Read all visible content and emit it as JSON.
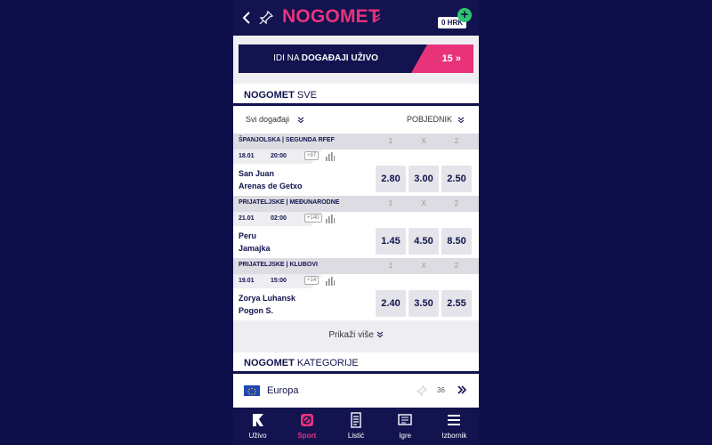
{
  "header": {
    "title": "NOGOMET",
    "wallet": "0 HRK",
    "wallet_plus": "+"
  },
  "live_banner": {
    "prefix": "IDI NA ",
    "bold": "DOGAĐAJI UŽIVO",
    "count": "15"
  },
  "section_all": {
    "bold": "NOGOMET",
    "rest": " SVE"
  },
  "filter": {
    "left": "Svi događaji",
    "right": "POBJEDNIK"
  },
  "odds_columns": [
    "1",
    "X",
    "2"
  ],
  "matches": [
    {
      "league": "ŠPANJOLSKA | SEGUNDA RFEF",
      "date": "18.01",
      "time": "20:00",
      "more": "+87",
      "team1": "San Juan",
      "team2": "Arenas de Getxo",
      "odds": [
        "2.80",
        "3.00",
        "2.50"
      ]
    },
    {
      "league": "PRIJATELJSKE | MEĐUNARODNE",
      "date": "21.01",
      "time": "02:00",
      "more": "+140",
      "team1": "Peru",
      "team2": "Jamajka",
      "odds": [
        "1.45",
        "4.50",
        "8.50"
      ]
    },
    {
      "league": "PRIJATELJSKE | KLUBOVI",
      "date": "19.01",
      "time": "15:00",
      "more": "+14",
      "team1": "Zorya Luhansk",
      "team2": "Pogon S.",
      "odds": [
        "2.40",
        "3.50",
        "2.55"
      ]
    }
  ],
  "show_more": "Prikaži više",
  "section_categories": {
    "bold": "NOGOMET",
    "rest": " KATEGORIJE"
  },
  "category": {
    "label": "Europa",
    "count": "36"
  },
  "bottom_nav": [
    {
      "label": "Uživo",
      "icon": "live-icon"
    },
    {
      "label": "Sport",
      "icon": "sport-icon"
    },
    {
      "label": "Listić",
      "icon": "ticket-icon"
    },
    {
      "label": "Igre",
      "icon": "games-icon"
    },
    {
      "label": "Izbornik",
      "icon": "menu-icon"
    }
  ],
  "colors": {
    "navy": "#12134f",
    "pink": "#e8337b",
    "green": "#2ec56e",
    "background": "#0d0e4a"
  }
}
